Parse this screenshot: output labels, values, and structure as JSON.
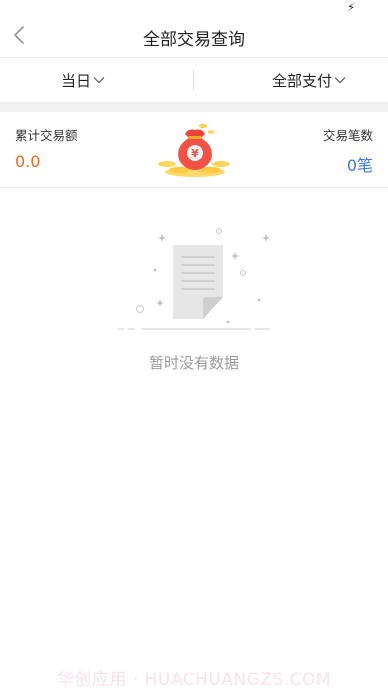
{
  "header": {
    "title": "全部交易查询"
  },
  "filters": {
    "date_label": "当日",
    "payment_label": "全部支付"
  },
  "summary": {
    "total_amount_label": "累计交易额",
    "total_amount_value": "0.0",
    "count_label": "交易笔数",
    "count_value": "0笔"
  },
  "empty_state": {
    "message": "暂时没有数据"
  },
  "watermark": "华创应用 · HUACHUANGZS.COM",
  "colors": {
    "amount_orange": "#f06a1f",
    "count_blue": "#3b7ad9",
    "empty_text_gray": "#9a9a9a"
  },
  "icons": {
    "back": "chevron-left-icon",
    "dropdown": "chevron-down-icon",
    "moneybag": "money-bag-icon",
    "empty_document": "empty-document-icon",
    "status_bolt": "charging-bolt-icon"
  }
}
